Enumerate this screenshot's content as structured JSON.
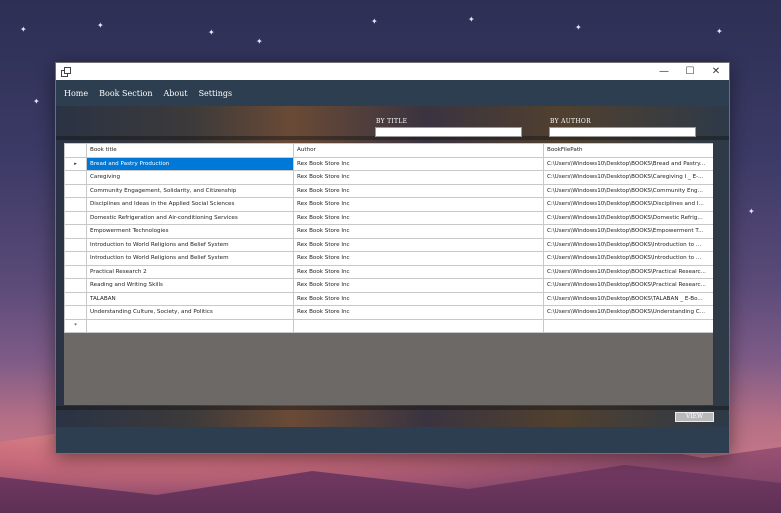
{
  "window": {
    "menu": [
      "Home",
      "Book Section",
      "About",
      "Settings"
    ],
    "controls": {
      "minimize": "—",
      "maximize": "☐",
      "close": "✕"
    }
  },
  "search": {
    "by_title_label": "BY TITLE",
    "by_title_value": "",
    "by_author_label": "BY AUTHOR",
    "by_author_value": ""
  },
  "grid": {
    "columns": [
      "Book title",
      "Author",
      "BookFilePath"
    ],
    "selected_row": 0,
    "rows": [
      [
        "Bread and Pastry Production",
        "Rex Book Store Inc",
        "C:\\Users\\Windows10\\Desktop\\BOOKS\\Bread and Pastry..."
      ],
      [
        "Caregiving",
        "Rex Book Store Inc",
        "C:\\Users\\Windows10\\Desktop\\BOOKS\\Caregiving I _ E-..."
      ],
      [
        "Community Engagement, Solidarity, and Citizenship",
        "Rex Book Store Inc",
        "C:\\Users\\Windows10\\Desktop\\BOOKS\\Community Eng..."
      ],
      [
        "Disciplines and Ideas in the Applied Social Sciences",
        "Rex Book Store Inc",
        "C:\\Users\\Windows10\\Desktop\\BOOKS\\Disciplines and I..."
      ],
      [
        "Domestic Refrigeration and Air-conditioning Services",
        "Rex Book Store Inc",
        "C:\\Users\\Windows10\\Desktop\\BOOKS\\Domestic Refrig..."
      ],
      [
        "Empowerment Technologies",
        "Rex Book Store Inc",
        "C:\\Users\\Windows10\\Desktop\\BOOKS\\Empowerment T..."
      ],
      [
        "Introduction to World Religions and Belief System",
        "Rex Book Store Inc",
        "C:\\Users\\Windows10\\Desktop\\BOOKS\\Introduction to ..."
      ],
      [
        "Introduction to World Religions and Belief System",
        "Rex Book Store Inc",
        "C:\\Users\\Windows10\\Desktop\\BOOKS\\Introduction to ..."
      ],
      [
        "Practical Research 2",
        "Rex Book Store Inc",
        "C:\\Users\\Windows10\\Desktop\\BOOKS\\Practical Researc..."
      ],
      [
        "Reading and Writing Skills",
        "Rex Book Store Inc",
        "C:\\Users\\Windows10\\Desktop\\BOOKS\\Practical Researc..."
      ],
      [
        "TALABAN",
        "Rex Book Store Inc",
        "C:\\Users\\Windows10\\Desktop\\BOOKS\\TALABAN _ E-Bo..."
      ],
      [
        "Understanding Culture, Society, and Politics",
        "Rex Book Store Inc",
        "C:\\Users\\Windows10\\Desktop\\BOOKS\\Understanding C..."
      ]
    ],
    "new_row_marker": "*",
    "current_row_marker": "▸"
  },
  "buttons": {
    "view": "VIEW"
  },
  "colors": {
    "accent": "#2c3e50",
    "selection": "#0078d7"
  }
}
